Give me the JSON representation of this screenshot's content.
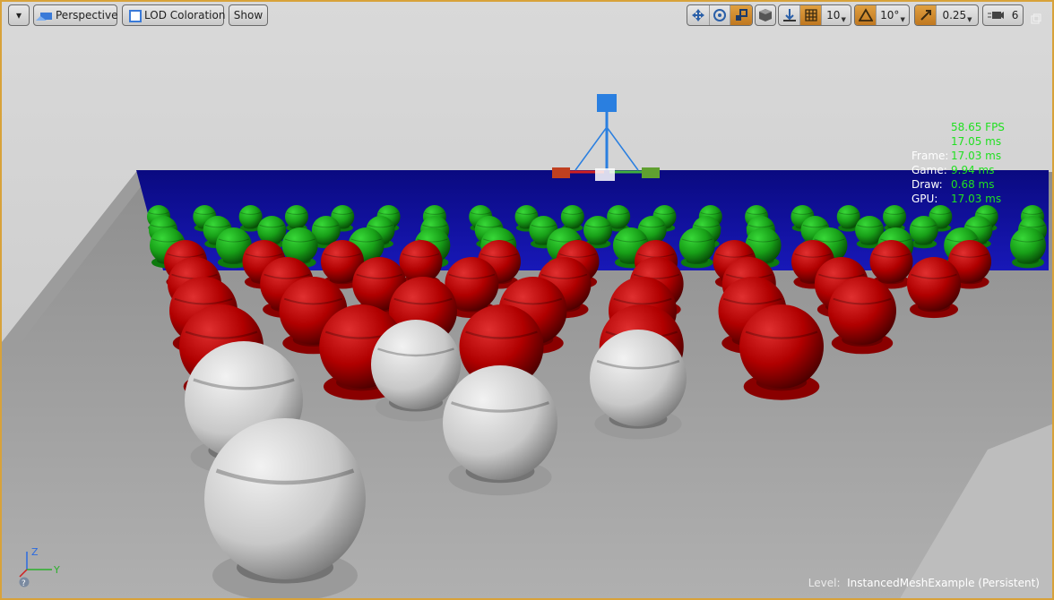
{
  "toolbar": {
    "menu_caret": "▾",
    "perspective_label": "Perspective",
    "view_mode_label": "LOD Coloration",
    "show_label": "Show",
    "grid_snap_value": "10",
    "rotation_snap_value": "10°",
    "scale_snap_value": "0.25",
    "camera_speed_value": "6"
  },
  "stats": {
    "fps": "58.65 FPS",
    "ms": "17.05 ms",
    "frame_label": "Frame:",
    "frame_value": "17.03 ms",
    "game_label": "Game:",
    "game_value": "9.94 ms",
    "draw_label": "Draw:",
    "draw_value": "0.68 ms",
    "gpu_label": "GPU:",
    "gpu_value": "17.03 ms"
  },
  "axes": {
    "z": "Z",
    "y": "Y",
    "help": "?"
  },
  "level": {
    "label": "Level:",
    "name": "InstancedMeshExample (Persistent)"
  },
  "colors": {
    "accent": "#d8a23a",
    "stat_green": "#21e021",
    "lod_red": "#b40000",
    "lod_green": "#1fa51f",
    "lod_blue": "#1010a8",
    "mesh_white": "#d8d8d8"
  }
}
